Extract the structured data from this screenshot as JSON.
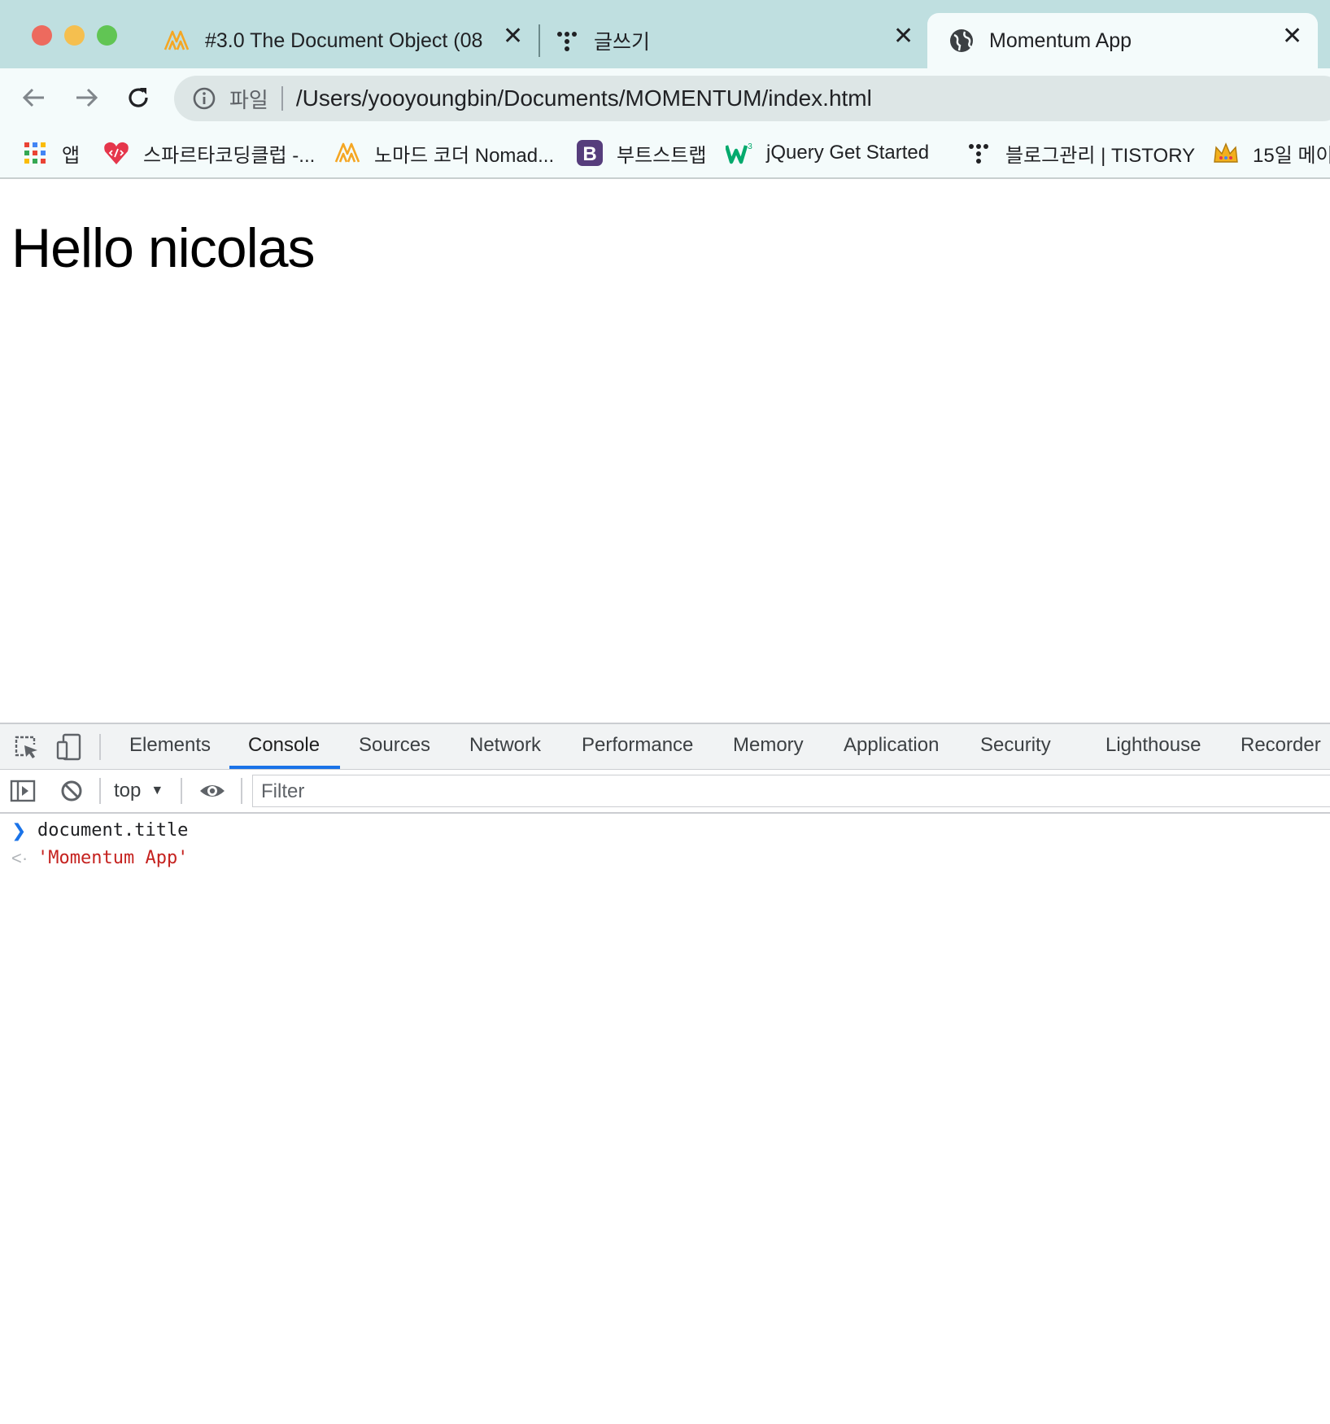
{
  "colors": {
    "tabstrip_bg": "#bfdfe0",
    "toolbar_bg": "#f4fbfb",
    "omnibox_bg": "#dde6e6",
    "traffic_close": "#ed6a5e",
    "traffic_minimize": "#f5bf4f",
    "traffic_zoom": "#61c554",
    "devtools_accent": "#1a73e8",
    "console_result": "#c5221f",
    "console_prompt": "#1a73e8"
  },
  "tabs": [
    {
      "title": "#3.0 The Document Object (08",
      "icon": "nomad-logo-icon",
      "active": false
    },
    {
      "title": "글쓰기",
      "icon": "tistory-dots-icon",
      "active": false
    },
    {
      "title": "Momentum App",
      "icon": "globe-icon",
      "active": true
    }
  ],
  "toolbar": {
    "security_label": "파일",
    "url": "/Users/yooyoungbin/Documents/MOMENTUM/index.html"
  },
  "bookmarks": [
    {
      "label": "앱",
      "icon": "apps-grid-icon"
    },
    {
      "label": "스파르타코딩클럽 -...",
      "icon": "sparta-heart-icon"
    },
    {
      "label": "노마드 코더 Nomad...",
      "icon": "nomad-logo-icon"
    },
    {
      "label": "부트스트랩",
      "icon": "bootstrap-icon"
    },
    {
      "label": "jQuery Get Started",
      "icon": "w3schools-icon"
    },
    {
      "label": "블로그관리 | TISTORY",
      "icon": "tistory-dots-icon"
    },
    {
      "label": "15일 메이",
      "icon": "crown-icon"
    }
  ],
  "page": {
    "heading": "Hello nicolas"
  },
  "devtools": {
    "tabs": [
      "Elements",
      "Console",
      "Sources",
      "Network",
      "Performance",
      "Memory",
      "Application",
      "Security",
      "Lighthouse",
      "Recorder"
    ],
    "active_tab": "Console",
    "context": "top",
    "filter_placeholder": "Filter",
    "console": {
      "input": "document.title",
      "output": "'Momentum App'"
    }
  }
}
